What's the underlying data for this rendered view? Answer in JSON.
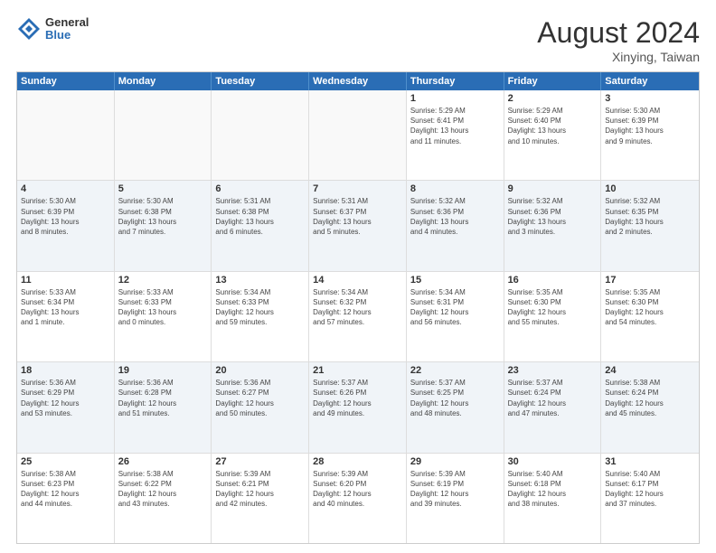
{
  "header": {
    "logo_general": "General",
    "logo_blue": "Blue",
    "month_year": "August 2024",
    "location": "Xinying, Taiwan"
  },
  "days_of_week": [
    "Sunday",
    "Monday",
    "Tuesday",
    "Wednesday",
    "Thursday",
    "Friday",
    "Saturday"
  ],
  "weeks": [
    [
      {
        "day": "",
        "info": ""
      },
      {
        "day": "",
        "info": ""
      },
      {
        "day": "",
        "info": ""
      },
      {
        "day": "",
        "info": ""
      },
      {
        "day": "1",
        "info": "Sunrise: 5:29 AM\nSunset: 6:41 PM\nDaylight: 13 hours\nand 11 minutes."
      },
      {
        "day": "2",
        "info": "Sunrise: 5:29 AM\nSunset: 6:40 PM\nDaylight: 13 hours\nand 10 minutes."
      },
      {
        "day": "3",
        "info": "Sunrise: 5:30 AM\nSunset: 6:39 PM\nDaylight: 13 hours\nand 9 minutes."
      }
    ],
    [
      {
        "day": "4",
        "info": "Sunrise: 5:30 AM\nSunset: 6:39 PM\nDaylight: 13 hours\nand 8 minutes."
      },
      {
        "day": "5",
        "info": "Sunrise: 5:30 AM\nSunset: 6:38 PM\nDaylight: 13 hours\nand 7 minutes."
      },
      {
        "day": "6",
        "info": "Sunrise: 5:31 AM\nSunset: 6:38 PM\nDaylight: 13 hours\nand 6 minutes."
      },
      {
        "day": "7",
        "info": "Sunrise: 5:31 AM\nSunset: 6:37 PM\nDaylight: 13 hours\nand 5 minutes."
      },
      {
        "day": "8",
        "info": "Sunrise: 5:32 AM\nSunset: 6:36 PM\nDaylight: 13 hours\nand 4 minutes."
      },
      {
        "day": "9",
        "info": "Sunrise: 5:32 AM\nSunset: 6:36 PM\nDaylight: 13 hours\nand 3 minutes."
      },
      {
        "day": "10",
        "info": "Sunrise: 5:32 AM\nSunset: 6:35 PM\nDaylight: 13 hours\nand 2 minutes."
      }
    ],
    [
      {
        "day": "11",
        "info": "Sunrise: 5:33 AM\nSunset: 6:34 PM\nDaylight: 13 hours\nand 1 minute."
      },
      {
        "day": "12",
        "info": "Sunrise: 5:33 AM\nSunset: 6:33 PM\nDaylight: 13 hours\nand 0 minutes."
      },
      {
        "day": "13",
        "info": "Sunrise: 5:34 AM\nSunset: 6:33 PM\nDaylight: 12 hours\nand 59 minutes."
      },
      {
        "day": "14",
        "info": "Sunrise: 5:34 AM\nSunset: 6:32 PM\nDaylight: 12 hours\nand 57 minutes."
      },
      {
        "day": "15",
        "info": "Sunrise: 5:34 AM\nSunset: 6:31 PM\nDaylight: 12 hours\nand 56 minutes."
      },
      {
        "day": "16",
        "info": "Sunrise: 5:35 AM\nSunset: 6:30 PM\nDaylight: 12 hours\nand 55 minutes."
      },
      {
        "day": "17",
        "info": "Sunrise: 5:35 AM\nSunset: 6:30 PM\nDaylight: 12 hours\nand 54 minutes."
      }
    ],
    [
      {
        "day": "18",
        "info": "Sunrise: 5:36 AM\nSunset: 6:29 PM\nDaylight: 12 hours\nand 53 minutes."
      },
      {
        "day": "19",
        "info": "Sunrise: 5:36 AM\nSunset: 6:28 PM\nDaylight: 12 hours\nand 51 minutes."
      },
      {
        "day": "20",
        "info": "Sunrise: 5:36 AM\nSunset: 6:27 PM\nDaylight: 12 hours\nand 50 minutes."
      },
      {
        "day": "21",
        "info": "Sunrise: 5:37 AM\nSunset: 6:26 PM\nDaylight: 12 hours\nand 49 minutes."
      },
      {
        "day": "22",
        "info": "Sunrise: 5:37 AM\nSunset: 6:25 PM\nDaylight: 12 hours\nand 48 minutes."
      },
      {
        "day": "23",
        "info": "Sunrise: 5:37 AM\nSunset: 6:24 PM\nDaylight: 12 hours\nand 47 minutes."
      },
      {
        "day": "24",
        "info": "Sunrise: 5:38 AM\nSunset: 6:24 PM\nDaylight: 12 hours\nand 45 minutes."
      }
    ],
    [
      {
        "day": "25",
        "info": "Sunrise: 5:38 AM\nSunset: 6:23 PM\nDaylight: 12 hours\nand 44 minutes."
      },
      {
        "day": "26",
        "info": "Sunrise: 5:38 AM\nSunset: 6:22 PM\nDaylight: 12 hours\nand 43 minutes."
      },
      {
        "day": "27",
        "info": "Sunrise: 5:39 AM\nSunset: 6:21 PM\nDaylight: 12 hours\nand 42 minutes."
      },
      {
        "day": "28",
        "info": "Sunrise: 5:39 AM\nSunset: 6:20 PM\nDaylight: 12 hours\nand 40 minutes."
      },
      {
        "day": "29",
        "info": "Sunrise: 5:39 AM\nSunset: 6:19 PM\nDaylight: 12 hours\nand 39 minutes."
      },
      {
        "day": "30",
        "info": "Sunrise: 5:40 AM\nSunset: 6:18 PM\nDaylight: 12 hours\nand 38 minutes."
      },
      {
        "day": "31",
        "info": "Sunrise: 5:40 AM\nSunset: 6:17 PM\nDaylight: 12 hours\nand 37 minutes."
      }
    ]
  ]
}
